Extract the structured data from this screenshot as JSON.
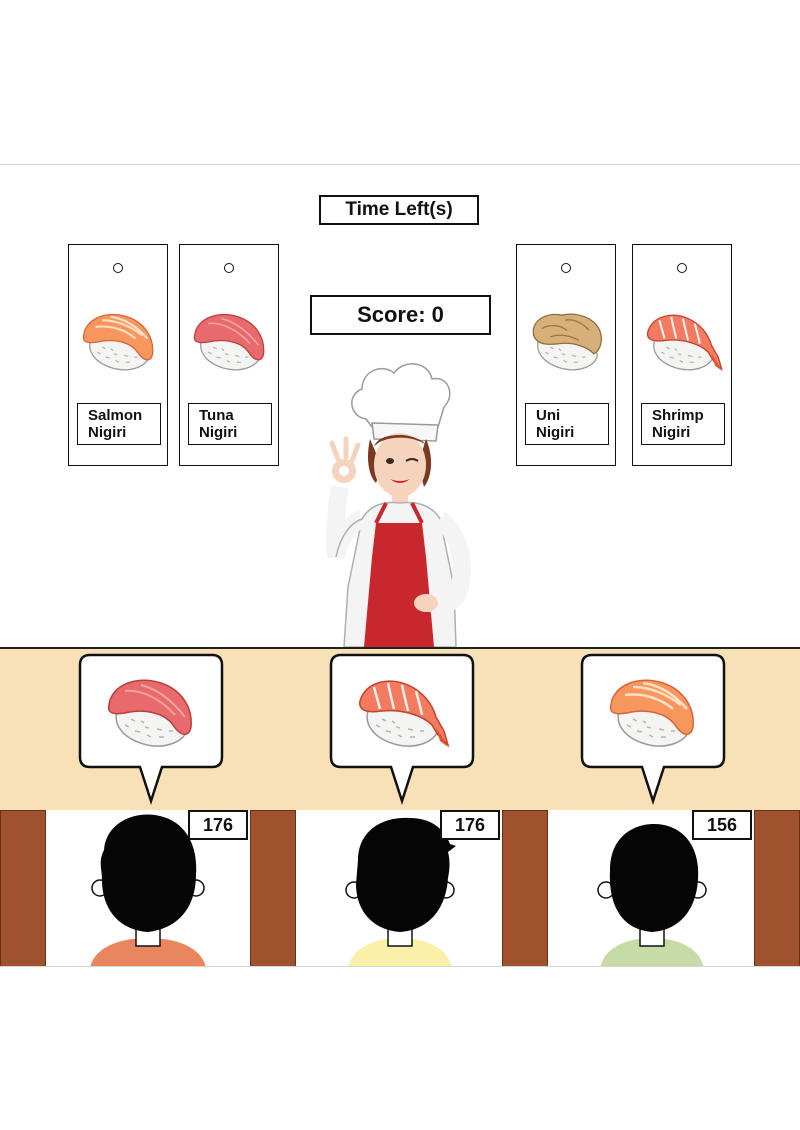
{
  "hud": {
    "timer_label": "Time Left(s)",
    "score_label": "Score: 0"
  },
  "menu_cards": [
    {
      "name": "Salmon\nNigiri",
      "sushi_icon": "salmon-nigiri-icon"
    },
    {
      "name": "Tuna\nNigiri",
      "sushi_icon": "tuna-nigiri-icon"
    },
    {
      "name": "Uni\nNigiri",
      "sushi_icon": "uni-nigiri-icon"
    },
    {
      "name": "Shrimp\nNigiri",
      "sushi_icon": "shrimp-nigiri-icon"
    }
  ],
  "customers": [
    {
      "order_icon": "tuna-nigiri-icon",
      "patience": "176",
      "shirt_color": "#e8875f"
    },
    {
      "order_icon": "shrimp-nigiri-icon",
      "patience": "176",
      "shirt_color": "#faf0a8"
    },
    {
      "order_icon": "salmon-nigiri-icon",
      "patience": "156",
      "shirt_color": "#c6dba6"
    }
  ],
  "colors": {
    "counter": "#f8e0b7",
    "wall": "#a0512e",
    "apron": "#c8282d",
    "salmon": "#f7975d",
    "tuna": "#e86a6c",
    "uni": "#d6b07a",
    "shrimp": "#f47a62"
  }
}
